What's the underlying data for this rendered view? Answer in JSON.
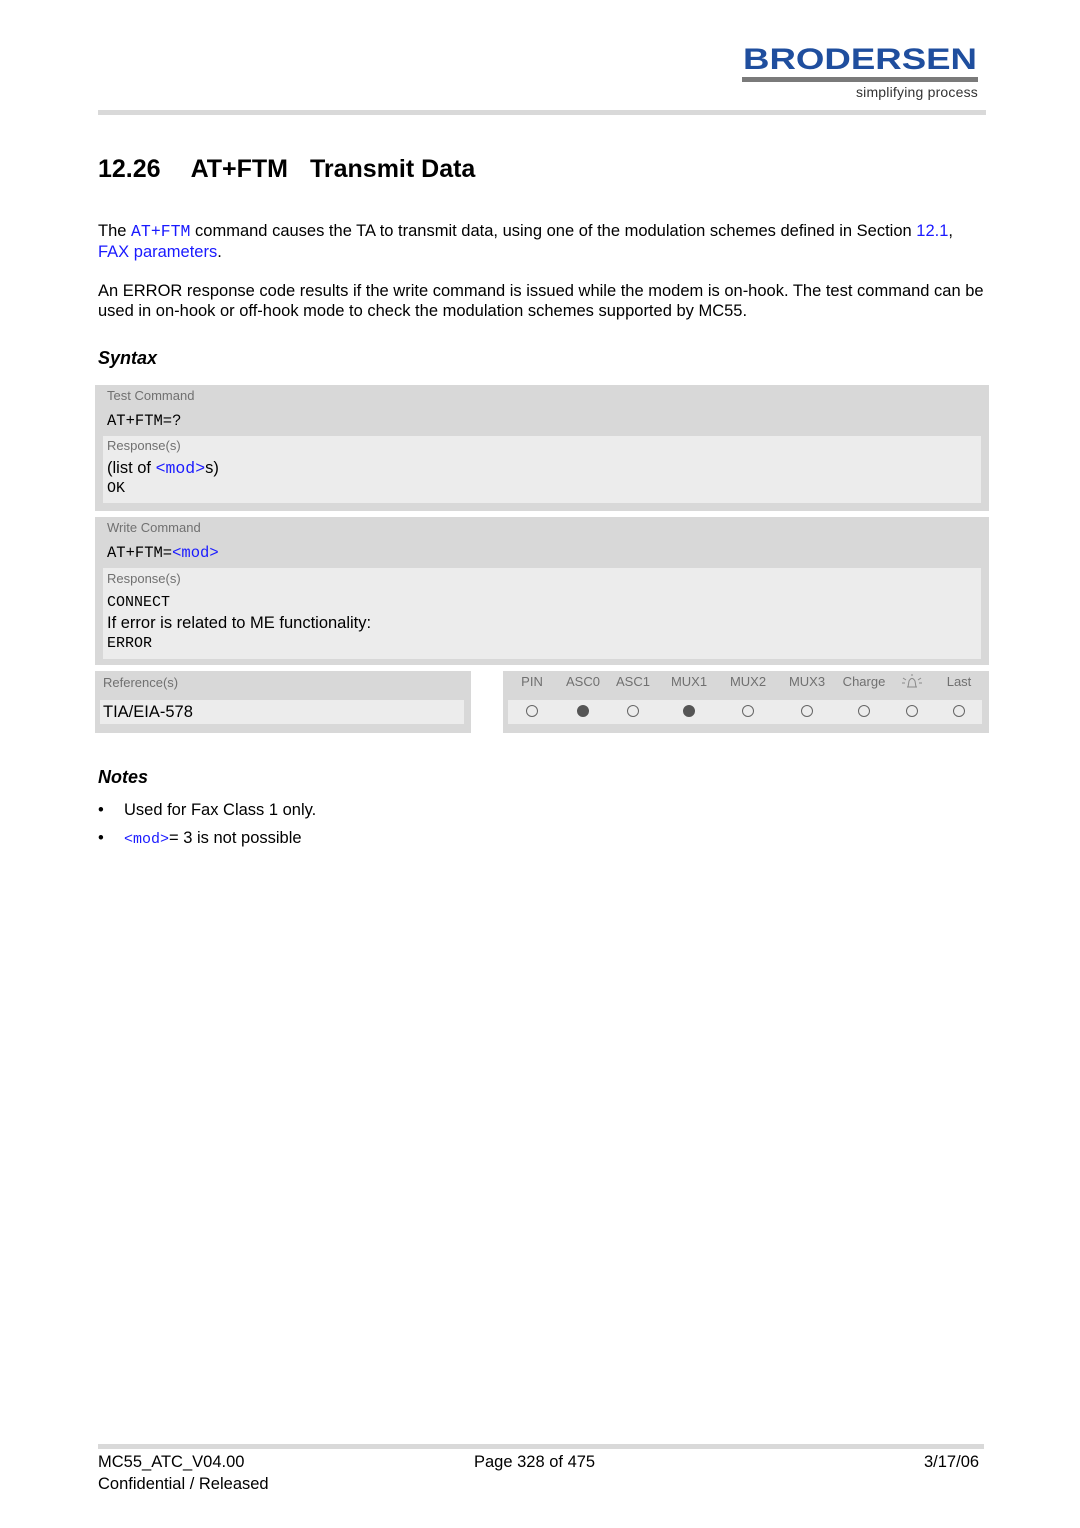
{
  "header": {
    "logo_text": "BRODERSEN",
    "logo_tagline": "simplifying process",
    "brand_color": "#1f4e9e"
  },
  "title": {
    "number": "12.26",
    "command": "AT+FTM",
    "name": "Transmit Data"
  },
  "intro": {
    "p1_prefix": "The ",
    "p1_cmd": "AT+FTM",
    "p1_text": " command causes the TA to transmit data, using one of the modulation schemes defined in Section ",
    "p1_link_num": "12.1",
    "p1_sep": ", ",
    "p1_link_text": "FAX parameters",
    "p1_end": ".",
    "p2": "An ERROR response code results if the write command is issued while the modem is on-hook. The test command can be used in on-hook or off-hook mode to check the modulation schemes supported by MC55."
  },
  "syntax": {
    "heading": "Syntax",
    "test": {
      "label": "Test Command",
      "command": "AT+FTM=?",
      "responses_label": "Response(s)",
      "resp_prefix": "(list of ",
      "resp_param": "<mod>",
      "resp_suffix": "s)",
      "resp_ok": "OK"
    },
    "write": {
      "label": "Write Command",
      "command_prefix": "AT+FTM=",
      "command_param": "<mod>",
      "responses_label": "Response(s)",
      "resp_connect": "CONNECT",
      "resp_note": "If error is related to ME functionality:",
      "resp_error": "ERROR"
    },
    "reference": {
      "label": "Reference(s)",
      "value": "TIA/EIA-578"
    },
    "flags": [
      {
        "label": "PIN",
        "on": false
      },
      {
        "label": "ASC0",
        "on": true
      },
      {
        "label": "ASC1",
        "on": false
      },
      {
        "label": "MUX1",
        "on": true
      },
      {
        "label": "MUX2",
        "on": false
      },
      {
        "label": "MUX3",
        "on": false
      },
      {
        "label": "Charge",
        "on": false
      },
      {
        "label": "",
        "icon": "alarm-bell-icon",
        "on": false
      },
      {
        "label": "Last",
        "on": false
      }
    ]
  },
  "notes": {
    "heading": "Notes",
    "bullet": "•",
    "n1": "Used for Fax Class 1 only.",
    "n2_param": "<mod>",
    "n2_text": "= 3 is not possible"
  },
  "footer": {
    "doc_id": "MC55_ATC_V04.00",
    "page": "Page 328 of 475",
    "date": "3/17/06",
    "status": "Confidential / Released"
  }
}
